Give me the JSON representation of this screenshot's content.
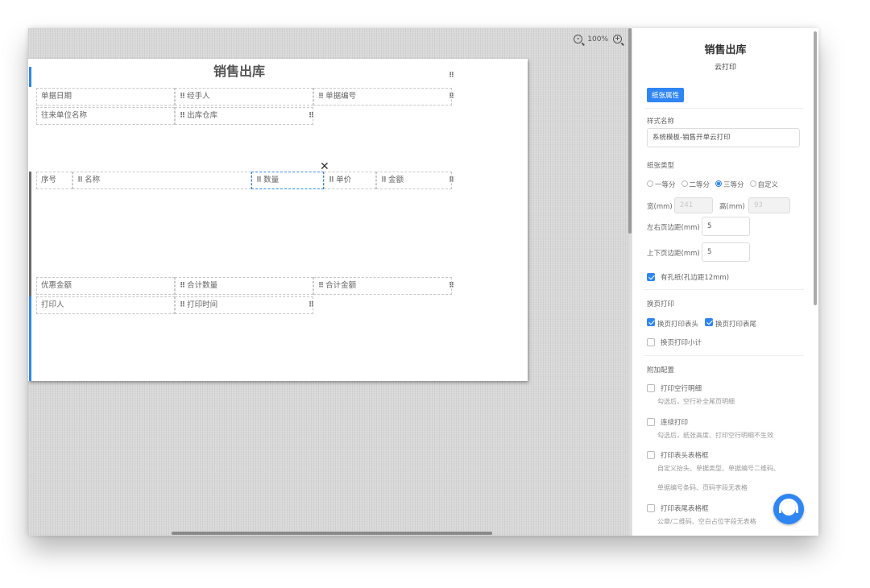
{
  "zoom": {
    "level": "100%"
  },
  "paper": {
    "title": "销售出库",
    "header_cells": [
      "单据日期",
      "经手人",
      "单据编号",
      "往来单位名称",
      "出库仓库"
    ],
    "table_cols": [
      "序号",
      "名称",
      "数量",
      "单价",
      "金额"
    ],
    "footer_cells": [
      "优惠金额",
      "合计数量",
      "合计金额",
      "打印人",
      "打印时间"
    ],
    "handle_glyph": "⠿",
    "close_glyph": "✕"
  },
  "panel": {
    "title": "销售出库",
    "subtitle": "云打印",
    "tab_label": "纸张属性",
    "style_name_label": "样式名称",
    "style_name_value": "系统模板-销售开单云打印",
    "paper_type_label": "纸张类型",
    "paper_types": [
      {
        "label": "一等分",
        "selected": false
      },
      {
        "label": "二等分",
        "selected": false
      },
      {
        "label": "三等分",
        "selected": true
      },
      {
        "label": "自定义",
        "selected": false
      }
    ],
    "width_label": "宽(mm)",
    "width_value": "241",
    "height_label": "高(mm)",
    "height_value": "93",
    "lr_margin_label": "左右页边距(mm)",
    "lr_margin_value": "5",
    "tb_margin_label": "上下页边距(mm)",
    "tb_margin_value": "5",
    "holes_label": "有孔纸(孔边距12mm)",
    "holes_checked": true,
    "page_print_label": "换页打印",
    "page_print_header": "换页打印表头",
    "page_print_header_checked": true,
    "page_print_footer": "换页打印表尾",
    "page_print_footer_checked": true,
    "page_print_subtotal": "换页打印小计",
    "page_print_subtotal_checked": false,
    "extra_label": "附加配置",
    "extras": [
      {
        "label": "打印空行明细",
        "desc": [
          "勾选后，空行补全尾页明细"
        ]
      },
      {
        "label": "连续打印",
        "desc": [
          "勾选后，纸张高度、打印空行明细不生效"
        ]
      },
      {
        "label": "打印表头表格框",
        "desc": [
          "自定义抬头、单据类型、单据编号二维码、",
          "单据编号条码、页码字段无表格"
        ]
      },
      {
        "label": "打印表尾表格框",
        "desc": [
          "公章/二维码、空白占位字段无表格"
        ]
      }
    ]
  },
  "colors": {
    "accent": "#2f86f3"
  }
}
